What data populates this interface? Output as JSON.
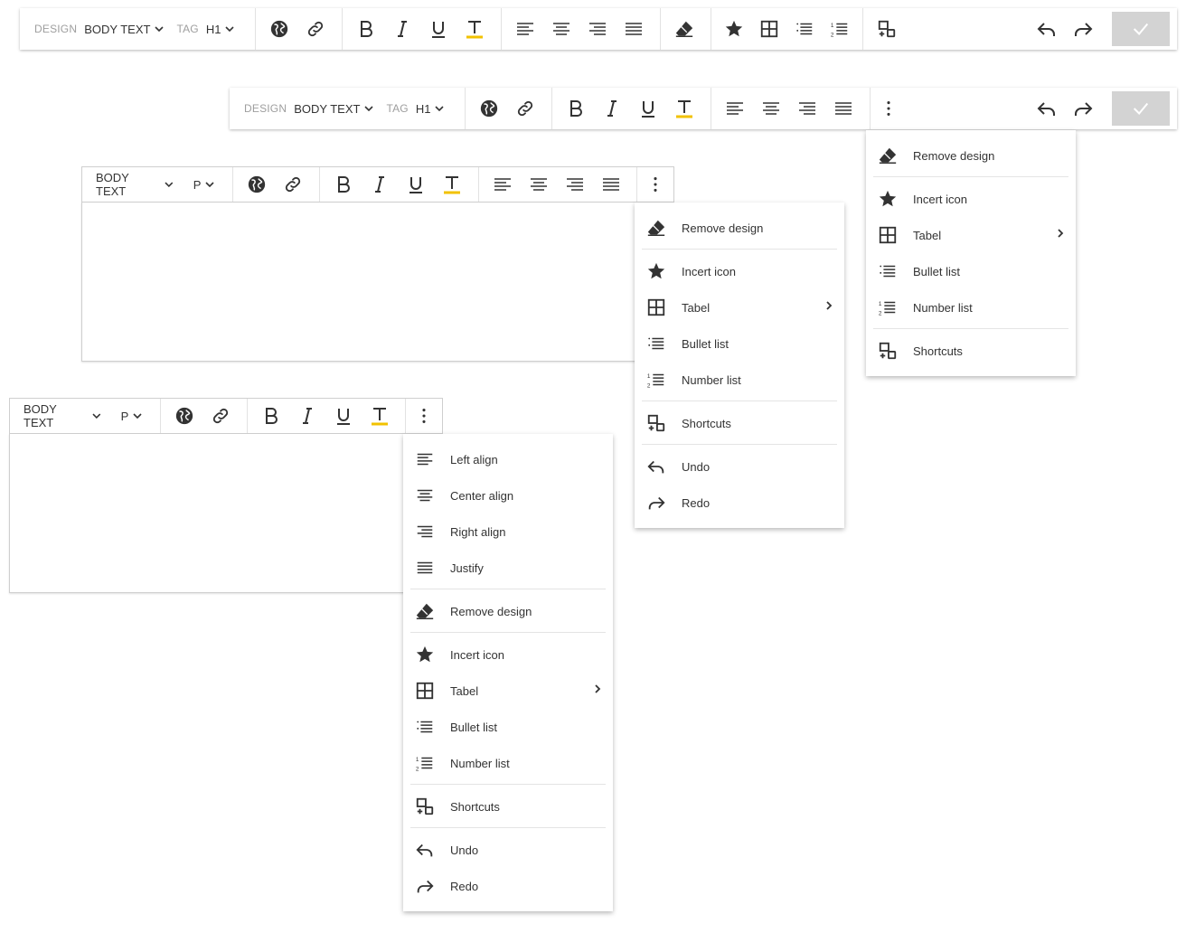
{
  "toolbar_full": {
    "design_label": "DESIGN",
    "design_value": "BODY TEXT",
    "tag_label": "TAG",
    "tag_value": "H1"
  },
  "toolbar_mid": {
    "design_label": "DESIGN",
    "design_value": "BODY TEXT",
    "tag_label": "TAG",
    "tag_value": "H1"
  },
  "toolbar_small": {
    "design_value": "BODY TEXT",
    "tag_value": "P"
  },
  "toolbar_xsmall": {
    "design_value": "BODY TEXT",
    "tag_value": "P"
  },
  "menu_mid": {
    "remove_design": "Remove design",
    "incert_icon": "Incert icon",
    "tabel": "Tabel",
    "bullet_list": "Bullet list",
    "number_list": "Number list",
    "shortcuts": "Shortcuts"
  },
  "menu_small": {
    "remove_design": "Remove design",
    "incert_icon": "Incert icon",
    "tabel": "Tabel",
    "bullet_list": "Bullet list",
    "number_list": "Number list",
    "shortcuts": "Shortcuts",
    "undo": "Undo",
    "redo": "Redo"
  },
  "menu_xsmall": {
    "left_align": "Left align",
    "center_align": "Center align",
    "right_align": "Right align",
    "justify": "Justify",
    "remove_design": "Remove design",
    "incert_icon": "Incert icon",
    "tabel": "Tabel",
    "bullet_list": "Bullet list",
    "number_list": "Number list",
    "shortcuts": "Shortcuts",
    "undo": "Undo",
    "redo": "Redo"
  },
  "colors": {
    "underline_accent": "#f2c200",
    "confirm_bg": "#d3d3d3",
    "icon": "#333333"
  }
}
